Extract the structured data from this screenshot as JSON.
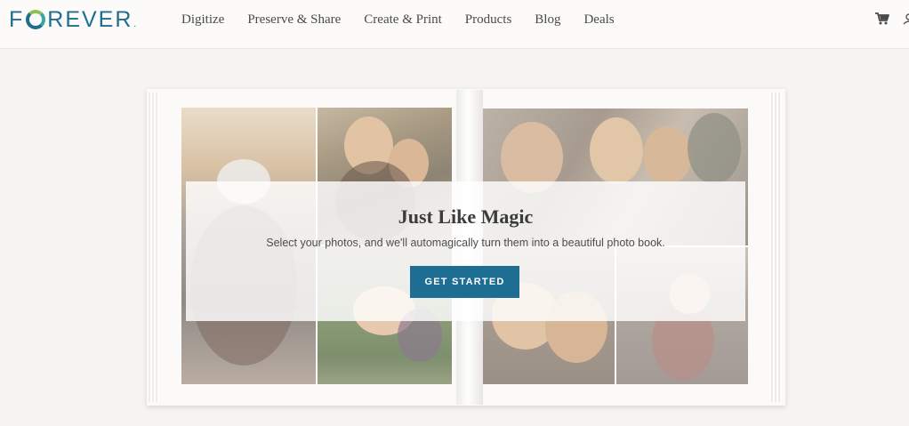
{
  "brand": {
    "logo_text": "FOREVER",
    "accent": "#1e6e94"
  },
  "nav": {
    "items": [
      {
        "label": "Digitize"
      },
      {
        "label": "Preserve & Share"
      },
      {
        "label": "Create & Print"
      },
      {
        "label": "Products"
      },
      {
        "label": "Blog"
      },
      {
        "label": "Deals"
      }
    ]
  },
  "header_icons": [
    "cart-icon",
    "account-icon"
  ],
  "hero": {
    "title": "Just Like Magic",
    "subtitle": "Select your photos, and we'll automagically turn them into a beautiful photo book.",
    "cta_label": "GET STARTED"
  }
}
